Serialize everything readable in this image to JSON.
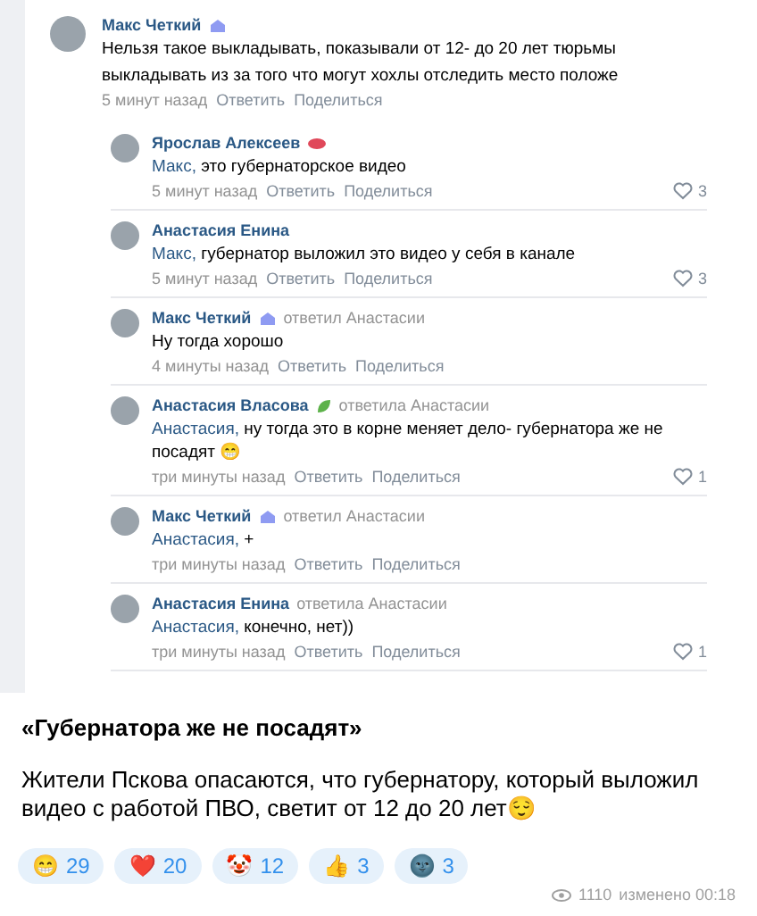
{
  "screenshot": {
    "comment": {
      "author": "Макс Четкий",
      "kind": "crystal",
      "text_lines": [
        "Нельзя такое выкладывать, показывали от 12- до 20 лет тюрьмы",
        "выкладывать из за того что могут хохлы отследить место положе"
      ],
      "time": "5 минут назад",
      "actions": [
        "Ответить",
        "Поделиться"
      ]
    },
    "replies": [
      {
        "author": "Ярослав Алексеев",
        "kind": "lips",
        "mention": "Макс,",
        "text": "это губернаторское видео",
        "time": "5 минут назад",
        "actions": [
          "Ответить",
          "Поделиться"
        ],
        "likes": "3"
      },
      {
        "author": "Анастасия Енина",
        "kind": "plain",
        "mention": "Макс,",
        "text": "губернатор выложил это видео у себя в канале",
        "time": "5 минут назад",
        "actions": [
          "Ответить",
          "Поделиться"
        ],
        "likes": "3"
      },
      {
        "author": "Макс Четкий",
        "kind": "crystal",
        "reply_to": "ответил Анастасии",
        "text": "Ну тогда хорошо",
        "time": "4 минуты назад",
        "actions": [
          "Ответить",
          "Поделиться"
        ]
      },
      {
        "author": "Анастасия Власова",
        "kind": "leaf",
        "reply_to": "ответила Анастасии",
        "mention": "Анастасия,",
        "text": "ну тогда это в корне меняет дело- губернатора же не посадят 😁",
        "time": "три минуты назад",
        "actions": [
          "Ответить",
          "Поделиться"
        ],
        "likes": "1"
      },
      {
        "author": "Макс Четкий",
        "kind": "crystal",
        "reply_to": "ответил Анастасии",
        "mention": "Анастасия,",
        "text": "+",
        "time": "три минуты назад",
        "actions": [
          "Ответить",
          "Поделиться"
        ]
      },
      {
        "author": "Анастасия Енина",
        "kind": "plain",
        "reply_to": "ответила Анастасии",
        "mention": "Анастасия,",
        "text": "конечно, нет))",
        "time": "три минуты назад",
        "actions": [
          "Ответить",
          "Поделиться"
        ],
        "likes": "1"
      }
    ]
  },
  "post": {
    "title": "«Губернатора же не посадят»",
    "text": "Жители Пскова опасаются, что губернатору, который выложил видео с работой ПВО, светит от 12 до 20 лет😌"
  },
  "reactions": [
    {
      "emoji": "😁",
      "count": "29"
    },
    {
      "emoji": "❤️",
      "count": "20"
    },
    {
      "emoji": "🤡",
      "count": "12"
    },
    {
      "emoji": "👍",
      "count": "3"
    },
    {
      "emoji": "🌚",
      "count": "3"
    }
  ],
  "footer": {
    "views": "1110",
    "edited": "изменено 00:18"
  }
}
